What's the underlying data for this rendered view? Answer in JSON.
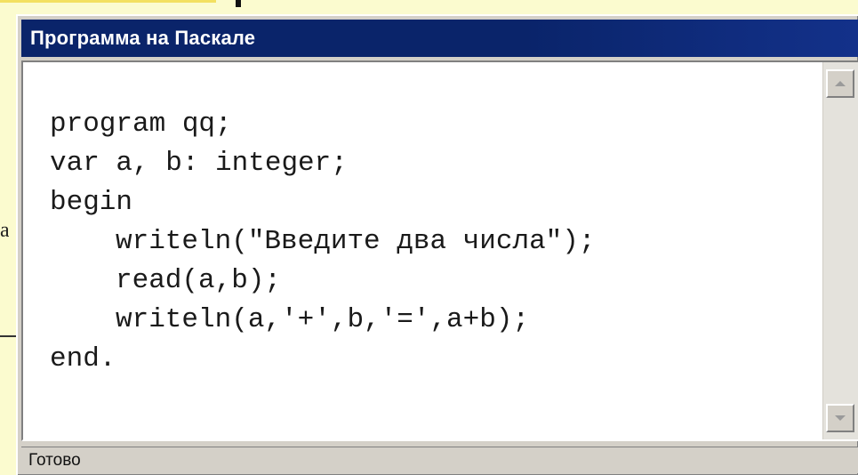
{
  "background_fragment": {
    "text": "а"
  },
  "window": {
    "title": "Программа на Паскале",
    "code_lines": [
      "program qq;",
      "var a, b: integer;",
      "begin",
      "writeln(\"Введите два числа\");",
      "read(a,b);",
      "writeln(a,'+',b,'=',a+b);",
      "end."
    ],
    "status": "Готово",
    "scrollbar": {
      "up_icon": "arrow-up-icon",
      "down_icon": "arrow-down-icon"
    }
  },
  "colors": {
    "title_bar": "#0a246a",
    "slide_background": "#fbfbcf",
    "window_chrome": "#d4d0c8"
  }
}
